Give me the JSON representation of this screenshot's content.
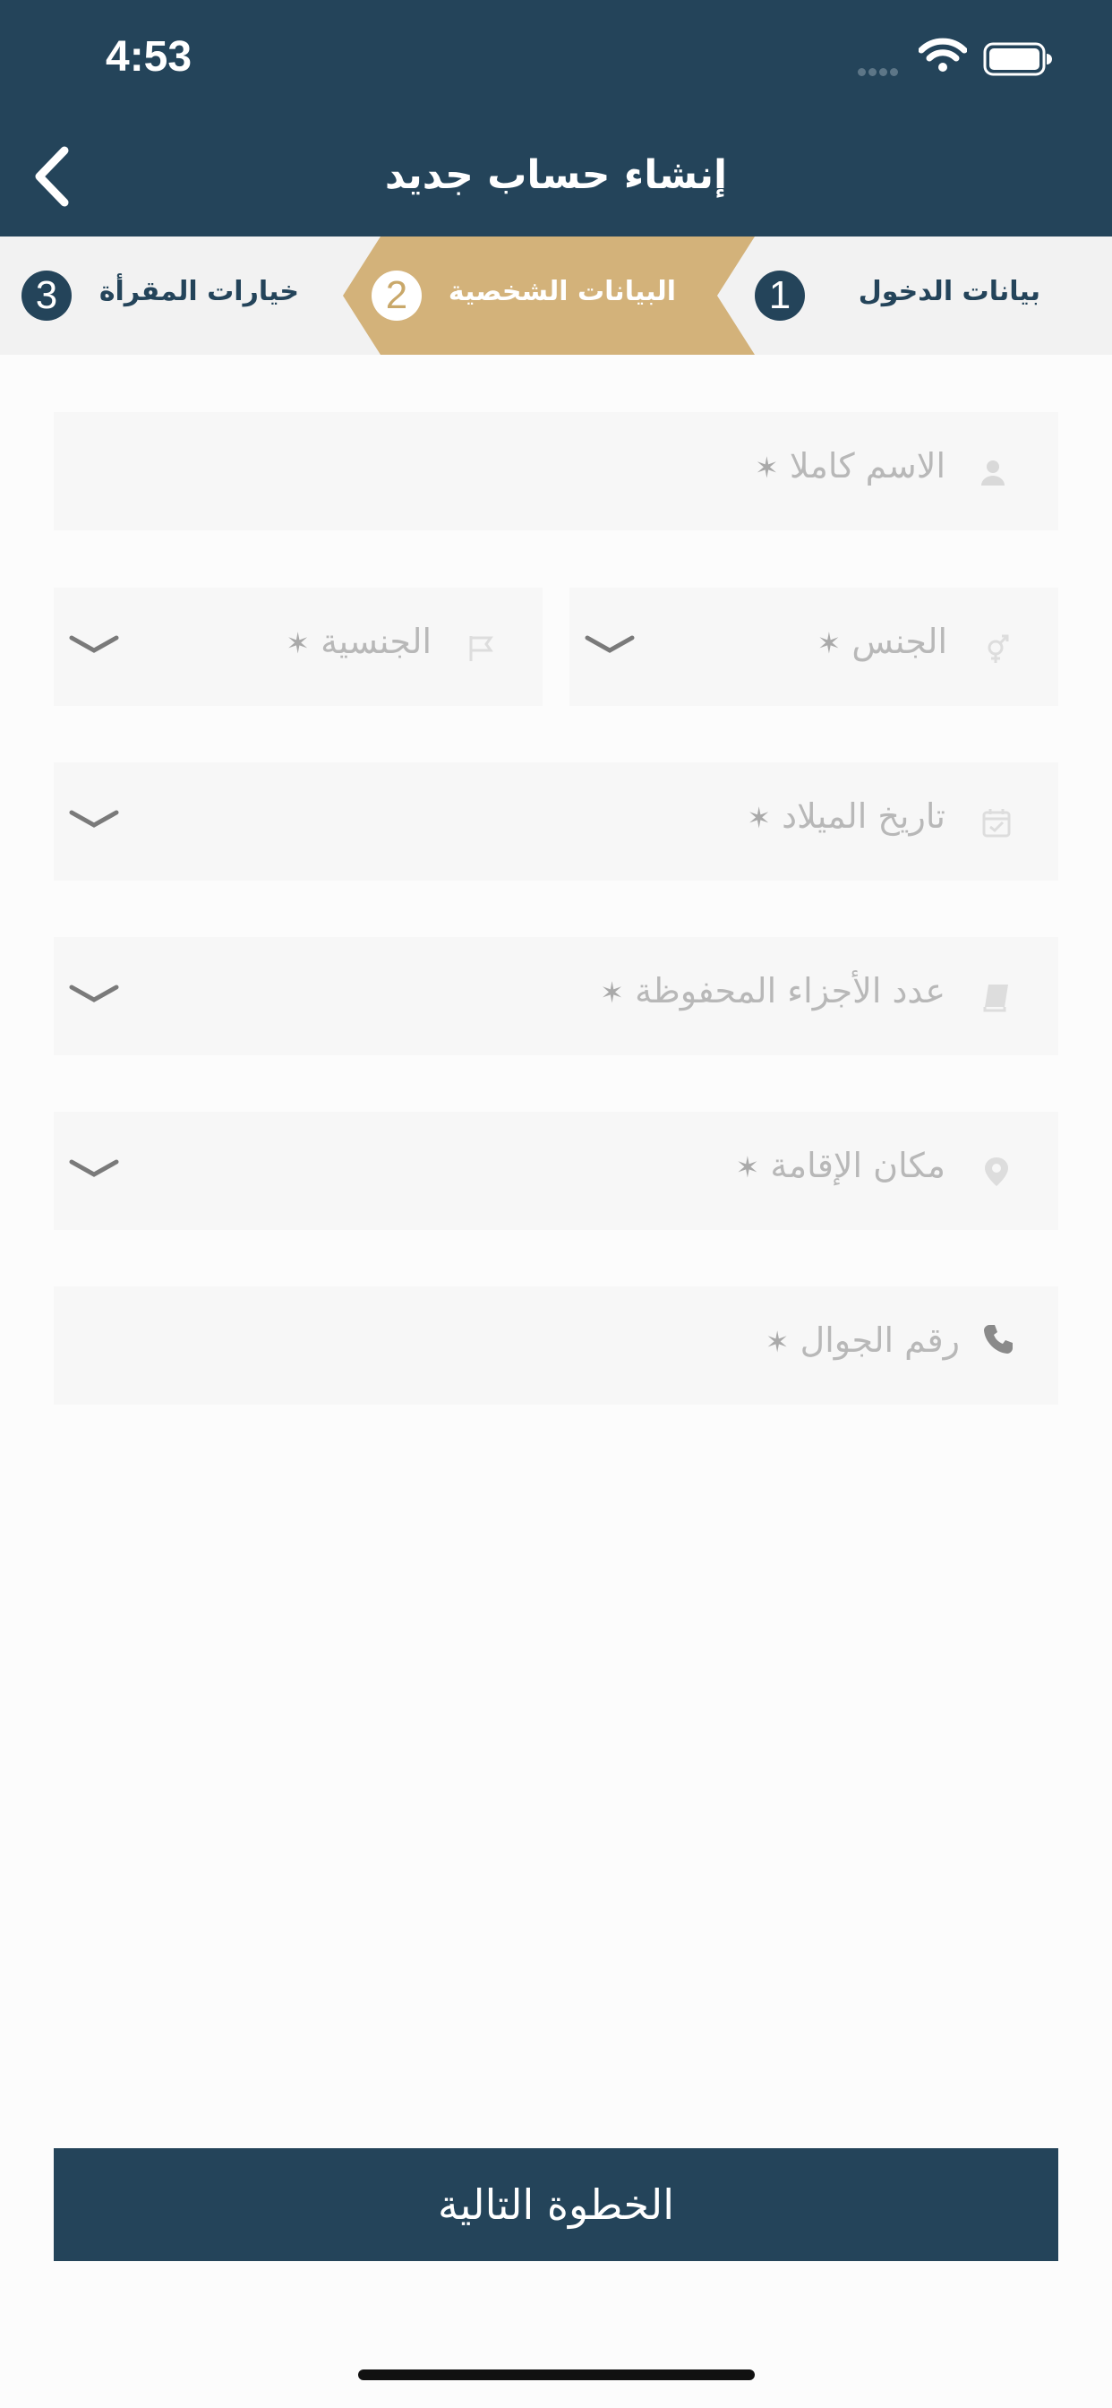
{
  "status_bar": {
    "time": "4:53"
  },
  "nav": {
    "title": "إنشاء حساب جديد"
  },
  "steps": [
    {
      "number": "1",
      "label": "بيانات الدخول"
    },
    {
      "number": "2",
      "label": "البيانات الشخصية"
    },
    {
      "number": "3",
      "label": "خيارات المقرأة"
    }
  ],
  "form": {
    "full_name": {
      "label": "الاسم كاملا",
      "required": "✶"
    },
    "gender": {
      "label": "الجنس",
      "required": "✶"
    },
    "nationality": {
      "label": "الجنسية",
      "required": "✶"
    },
    "birth_date": {
      "label": "تاريخ الميلاد",
      "required": "✶"
    },
    "memorized_parts": {
      "label": "عدد الأجزاء المحفوظة",
      "required": "✶"
    },
    "residence": {
      "label": "مكان الإقامة",
      "required": "✶"
    },
    "mobile": {
      "label": "رقم الجوال",
      "required": "✶"
    }
  },
  "actions": {
    "next_label": "الخطوة التالية"
  },
  "colors": {
    "primary": "#24445a",
    "accent": "#d3b27a",
    "field_bg": "#f7f7f7",
    "placeholder": "#b8b8b8"
  }
}
